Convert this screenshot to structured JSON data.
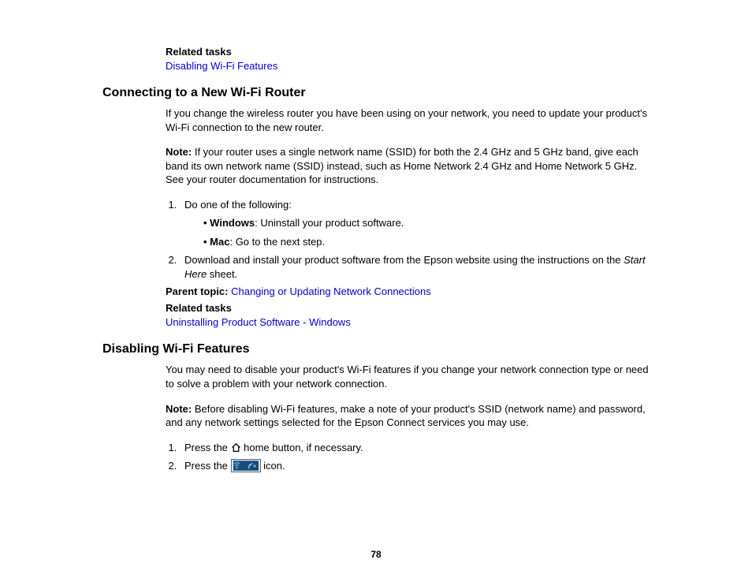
{
  "section0": {
    "relatedTasksHeading": "Related tasks",
    "link": "Disabling Wi-Fi Features"
  },
  "section1": {
    "heading": "Connecting to a New Wi-Fi Router",
    "intro": "If you change the wireless router you have been using on your network, you need to update your product's Wi-Fi connection to the new router.",
    "noteLabel": "Note:",
    "noteBody": " If your router uses a single network name (SSID) for both the 2.4 GHz and 5 GHz band, give each band its own network name (SSID) instead, such as Home Network 2.4 GHz and Home Network 5 GHz. See your router documentation for instructions.",
    "step1Intro": "Do one of the following:",
    "bullet1Bold": "Windows",
    "bullet1Rest": ": Uninstall your product software.",
    "bullet2Bold": "Mac",
    "bullet2Rest": ": Go to the next step.",
    "step2a": "Download and install your product software from the Epson website using the instructions on the ",
    "step2Italic": "Start Here",
    "step2b": " sheet.",
    "parentLabel": "Parent topic:",
    "parentLink": "Changing or Updating Network Connections",
    "relatedTasksHeading": "Related tasks",
    "relatedLink": "Uninstalling Product Software - Windows"
  },
  "section2": {
    "heading": "Disabling Wi-Fi Features",
    "intro": "You may need to disable your product's Wi-Fi features if you change your network connection type or need to solve a problem with your network connection.",
    "noteLabel": "Note:",
    "noteBody": " Before disabling Wi-Fi features, make a note of your product's SSID (network name) and password, and any network settings selected for the Epson Connect services you may use.",
    "step1a": "Press the ",
    "step1b": " home button, if necessary.",
    "step2a": "Press the ",
    "step2b": " icon."
  },
  "pageNumber": "78"
}
